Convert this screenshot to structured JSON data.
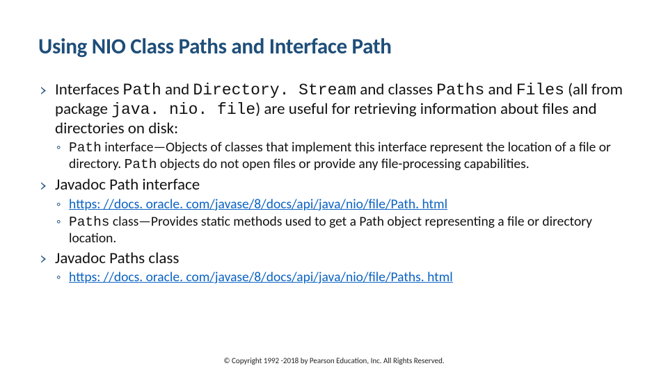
{
  "title": "Using NIO Class Paths and Interface Path",
  "b1": {
    "pre": "Interfaces ",
    "m1": "Path",
    "t2": " and ",
    "m2": "Directory. Stream",
    "t3": " and classes ",
    "m3": "Paths",
    "t4": " and ",
    "m4": "Files",
    "t5": " (all from package ",
    "m5": "java. nio. file",
    "t6": ") are useful for retrieving information about files and directories on disk:"
  },
  "s1": {
    "m1": "Path",
    "t1": " interface—Objects of classes that implement this interface represent the location of a file or directory. ",
    "m2": "Path",
    "t2": " objects do not open files or provide any file-processing capabilities."
  },
  "b2": "Javadoc Path interface",
  "s2a": "https: //docs. oracle. com/javase/8/docs/api/java/nio/file/Path. html",
  "s2b": {
    "m1": "Paths",
    "t1": " class—Provides static methods used to get a Path object representing a file or directory location."
  },
  "b3": "Javadoc Paths class",
  "s3a": "https: //docs. oracle. com/javase/8/docs/api/java/nio/file/Paths. html",
  "footer": "© Copyright 1992 -2018 by Pearson Education, Inc. All Rights Reserved."
}
